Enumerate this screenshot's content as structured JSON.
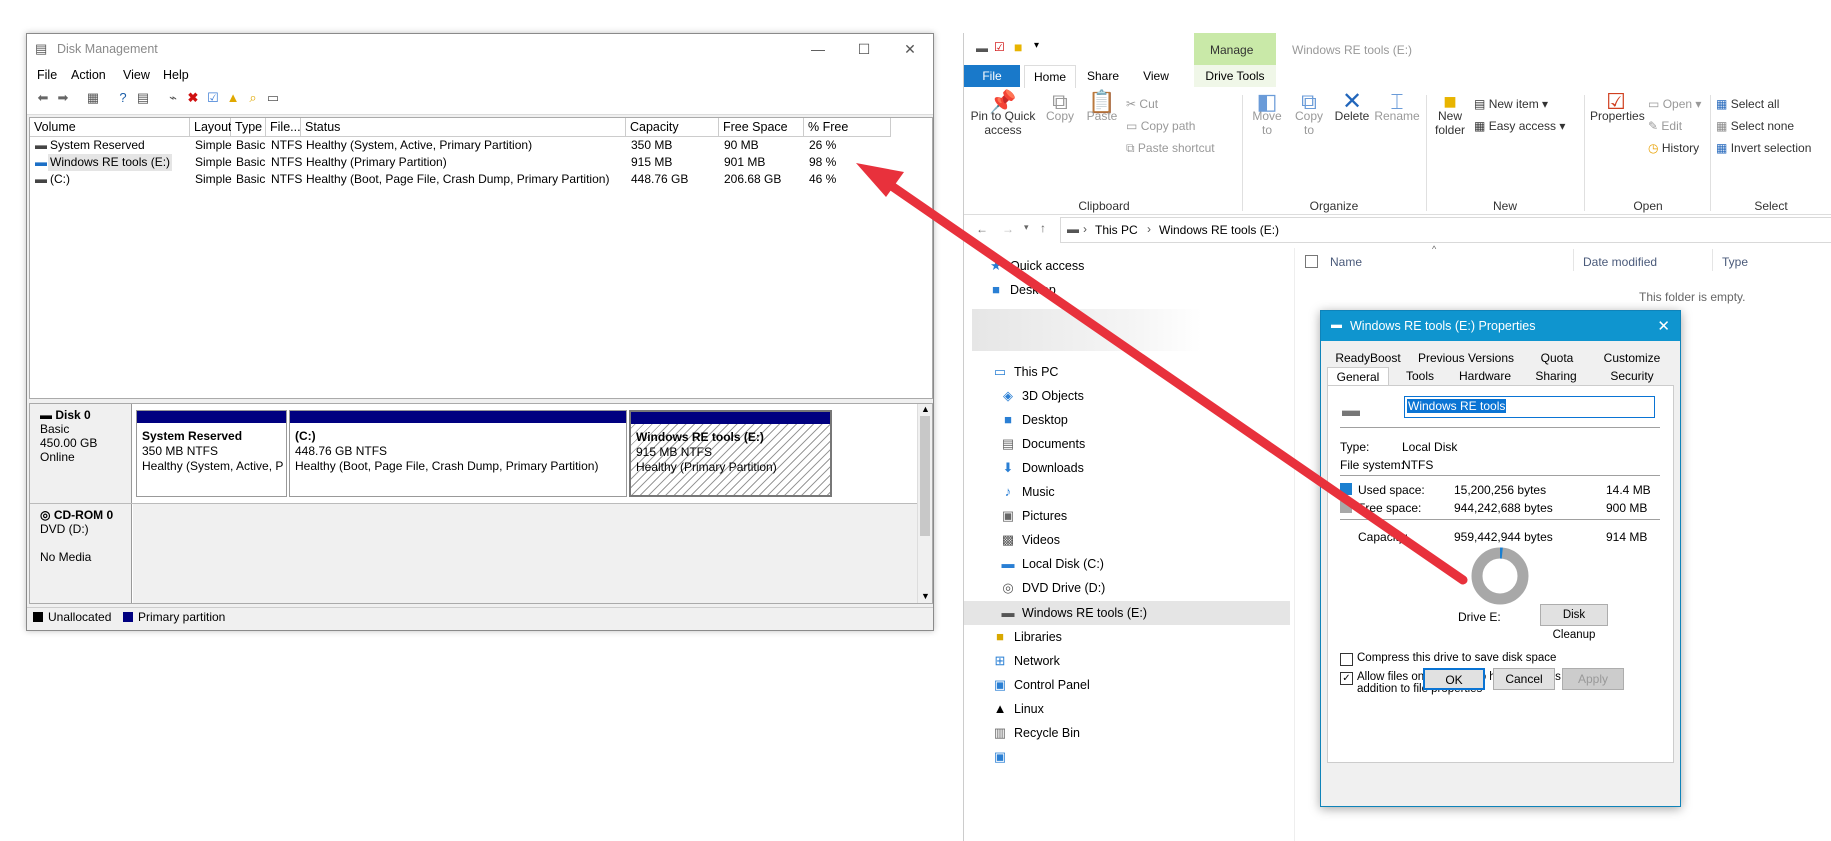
{
  "disk_management": {
    "title": "Disk Management",
    "menu": [
      "File",
      "Action",
      "View",
      "Help"
    ],
    "columns": [
      "Volume",
      "Layout",
      "Type",
      "File...",
      "Status",
      "Capacity",
      "Free Space",
      "% Free"
    ],
    "rows": [
      {
        "volume": "System Reserved",
        "layout": "Simple",
        "type": "Basic",
        "fs": "NTFS",
        "status": "Healthy (System, Active, Primary Partition)",
        "capacity": "350 MB",
        "free": "90 MB",
        "pct": "26 %"
      },
      {
        "volume": "Windows RE tools (E:)",
        "layout": "Simple",
        "type": "Basic",
        "fs": "NTFS",
        "status": "Healthy (Primary Partition)",
        "capacity": "915 MB",
        "free": "901 MB",
        "pct": "98 %"
      },
      {
        "volume": "(C:)",
        "layout": "Simple",
        "type": "Basic",
        "fs": "NTFS",
        "status": "Healthy (Boot, Page File, Crash Dump, Primary Partition)",
        "capacity": "448.76 GB",
        "free": "206.68 GB",
        "pct": "46 %"
      }
    ],
    "disk0": {
      "name": "Disk 0",
      "type": "Basic",
      "size": "450.00 GB",
      "state": "Online"
    },
    "partitions": [
      {
        "name": "System Reserved",
        "size": "350 MB NTFS",
        "status": "Healthy (System, Active, Prima"
      },
      {
        "name": "(C:)",
        "size": "448.76 GB NTFS",
        "status": "Healthy (Boot, Page File, Crash Dump, Primary Partition)"
      },
      {
        "name": "Windows RE tools  (E:)",
        "size": "915 MB NTFS",
        "status": "Healthy (Primary Partition)"
      }
    ],
    "cdrom": {
      "name": "CD-ROM 0",
      "drive": "DVD (D:)",
      "media": "No Media"
    },
    "legend": [
      "Unallocated",
      "Primary partition"
    ]
  },
  "explorer": {
    "tabs": {
      "file": "File",
      "home": "Home",
      "share": "Share",
      "view": "View",
      "manage": "Manage",
      "drive_tools": "Drive Tools"
    },
    "window_title": "Windows RE tools (E:)",
    "ribbon": {
      "pin": "Pin to Quick access",
      "copy": "Copy",
      "paste": "Paste",
      "cut": "Cut",
      "copy_path": "Copy path",
      "paste_shortcut": "Paste shortcut",
      "move_to": "Move to",
      "copy_to": "Copy to",
      "delete": "Delete",
      "rename": "Rename",
      "new_folder": "New folder",
      "new_item": "New item",
      "easy_access": "Easy access",
      "properties": "Properties",
      "open": "Open",
      "edit": "Edit",
      "history": "History",
      "select_all": "Select all",
      "select_none": "Select none",
      "invert": "Invert selection",
      "groups": [
        "Clipboard",
        "Organize",
        "New",
        "Open",
        "Select"
      ]
    },
    "breadcrumb": [
      "This PC",
      "Windows RE tools (E:)"
    ],
    "columns": [
      "Name",
      "Date modified",
      "Type"
    ],
    "empty_text": "This folder is empty.",
    "nav": {
      "quick_access": "Quick access",
      "desktop_top": "Desktop",
      "this_pc": "This PC",
      "objects3d": "3D Objects",
      "desktop": "Desktop",
      "documents": "Documents",
      "downloads": "Downloads",
      "music": "Music",
      "pictures": "Pictures",
      "videos": "Videos",
      "local_c": "Local Disk (C:)",
      "dvd": "DVD Drive (D:)",
      "winre": "Windows RE tools (E:)",
      "libraries": "Libraries",
      "network": "Network",
      "control_panel": "Control Panel",
      "linux": "Linux",
      "recycle_bin": "Recycle Bin"
    }
  },
  "properties": {
    "title": "Windows RE tools (E:) Properties",
    "tabs_top": [
      "ReadyBoost",
      "Previous Versions",
      "Quota",
      "Customize"
    ],
    "tabs_bottom": [
      "General",
      "Tools",
      "Hardware",
      "Sharing",
      "Security"
    ],
    "label_value": "Windows RE tools",
    "type_label": "Type:",
    "type_value": "Local Disk",
    "fs_label": "File system:",
    "fs_value": "NTFS",
    "used_label": "Used space:",
    "used_bytes": "15,200,256 bytes",
    "used_size": "14.4 MB",
    "free_label": "Free space:",
    "free_bytes": "944,242,688 bytes",
    "free_size": "900 MB",
    "cap_label": "Capacity:",
    "cap_bytes": "959,442,944 bytes",
    "cap_size": "914 MB",
    "used_fraction": 0.016,
    "drive_label": "Drive E:",
    "disk_cleanup": "Disk Cleanup",
    "compress": "Compress this drive to save disk space",
    "index": "Allow files on this drive to have contents indexed in addition to file properties",
    "ok": "OK",
    "cancel": "Cancel",
    "apply": "Apply"
  },
  "colors": {
    "accent": "#0f95cf",
    "arrow": "#e8313c",
    "partition": "#000080",
    "ribbon_file": "#1979ca",
    "manage": "#c9e9a8"
  }
}
